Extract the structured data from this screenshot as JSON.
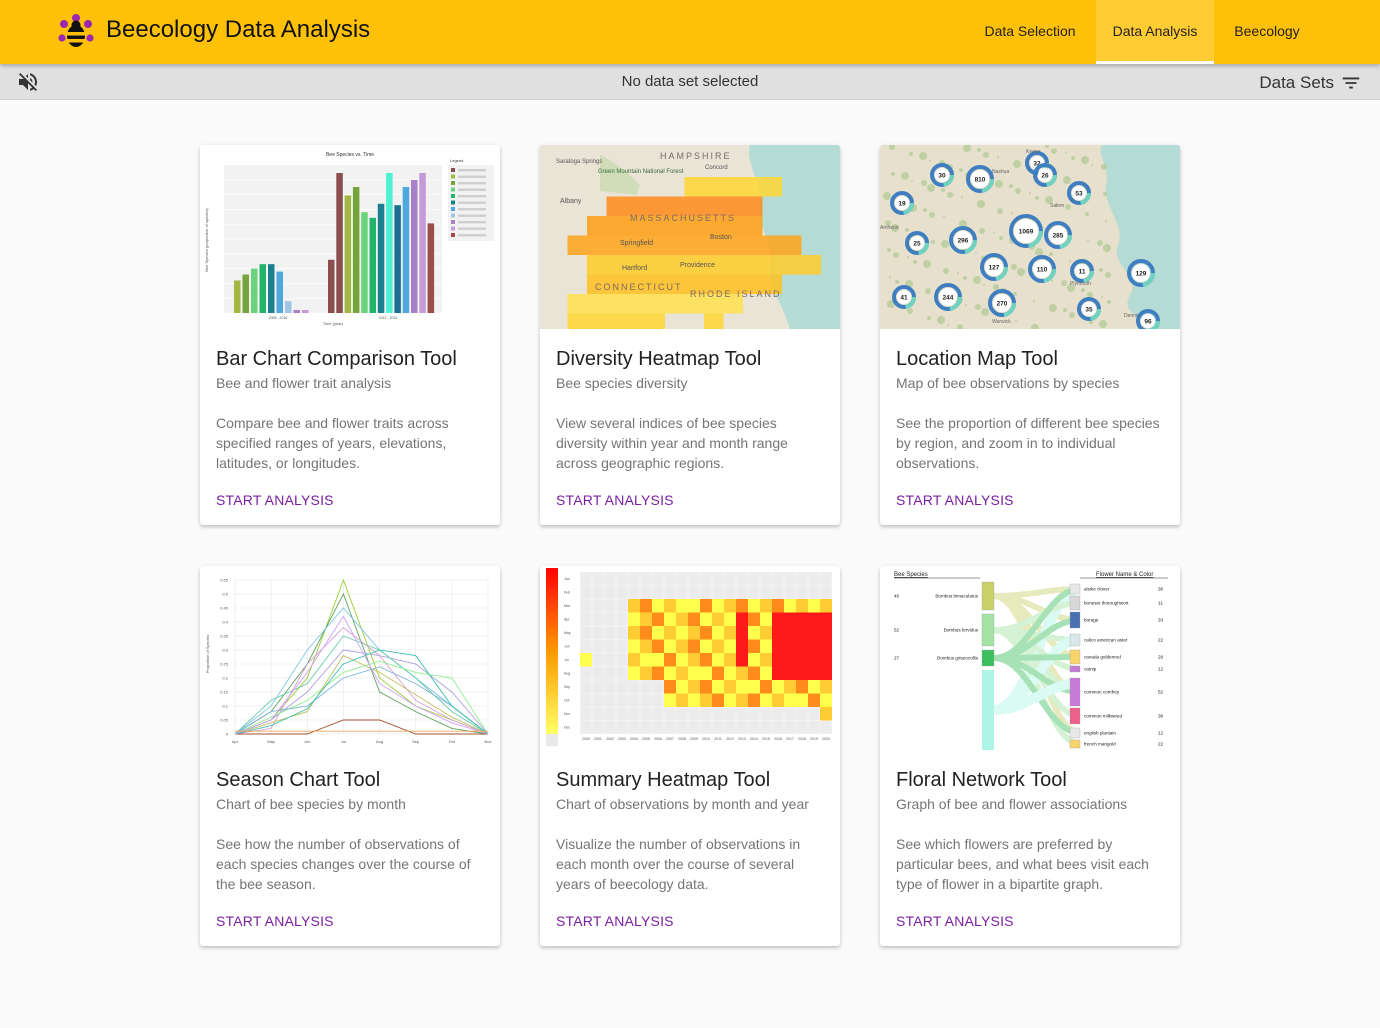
{
  "header": {
    "app_title": "Beecology Data Analysis",
    "nav": [
      {
        "label": "Data Selection",
        "active": false
      },
      {
        "label": "Data Analysis",
        "active": true
      },
      {
        "label": "Beecology",
        "active": false
      }
    ],
    "brand_color": "#ffc107"
  },
  "subbar": {
    "mute_icon": "volume-off-icon",
    "status": "No data set selected",
    "datasets_label": "Data Sets",
    "filter_icon": "filter-icon"
  },
  "cards": [
    {
      "title": "Bar Chart Comparison Tool",
      "subtitle": "Bee and flower trait analysis",
      "description": "Compare bee and flower traits across specified ranges of years, elevations, latitudes, or longitudes.",
      "action": "START ANALYSIS"
    },
    {
      "title": "Diversity Heatmap Tool",
      "subtitle": "Bee species diversity",
      "description": "View several indices of bee species diversity within year and month range across geographic regions.",
      "action": "START ANALYSIS"
    },
    {
      "title": "Location Map Tool",
      "subtitle": "Map of bee observations by species",
      "description": "See the proportion of different bee species by region, and zoom in to individual observations.",
      "action": "START ANALYSIS"
    },
    {
      "title": "Season Chart Tool",
      "subtitle": "Chart of bee species by month",
      "description": "See how the number of observations of each species changes over the course of the bee season.",
      "action": "START ANALYSIS"
    },
    {
      "title": "Summary Heatmap Tool",
      "subtitle": "Chart of observations by month and year",
      "description": "Visualize the number of observations in each month over the course of several years of beecology data.",
      "action": "START ANALYSIS"
    },
    {
      "title": "Floral Network Tool",
      "subtitle": "Graph of bee and flower associations",
      "description": "See which flowers are preferred by particular bees, and what bees visit each type of flower in a bipartite graph.",
      "action": "START ANALYSIS"
    }
  ],
  "thumbnails": {
    "bar_chart": {
      "title": "Bee Species vs. Time",
      "ylabel": "Bee Species (proportion of species)",
      "xlabel": "Time (year)",
      "legend_title": "Legend",
      "group_labels": [
        "2008 - 2016",
        "2012 - 2019"
      ]
    },
    "map_labels": {
      "diversity": [
        "HAMPSHIRE",
        "MASSACHUSETTS",
        "CONNECTICUT",
        "RHODE ISLAND",
        "Albany",
        "Saratoga Springs",
        "Green Mountain National Forest",
        "Concord",
        "Boston",
        "Springfield",
        "Hartford",
        "Providence"
      ],
      "location": [
        "Keene",
        "Nashua",
        "Salem",
        "Amherst",
        "Plymouth",
        "Dennis",
        "Warwick"
      ]
    },
    "clusters": [
      32,
      30,
      810,
      26,
      53,
      19,
      1069,
      285,
      25,
      296,
      127,
      110,
      11,
      129,
      41,
      244,
      270,
      35,
      96
    ],
    "season_months": [
      "Apr",
      "May",
      "Jun",
      "Jul",
      "Aug",
      "Sep",
      "Oct",
      "Nov"
    ],
    "season_ylabel": "Proportion of Species",
    "season_yticks": [
      "0.55",
      "0.5",
      "0.45",
      "0.4",
      "0.35",
      "0.3",
      "0.25",
      "0.2",
      "0.15",
      "0.1",
      "0.05",
      "0"
    ],
    "summary_months": [
      "Jan",
      "Feb",
      "Mar",
      "Apr",
      "May",
      "Jun",
      "Jul",
      "Aug",
      "Sep",
      "Oct",
      "Nov",
      "Dec"
    ],
    "summary_years": [
      "2000",
      "2001",
      "2002",
      "2003",
      "2004",
      "2005",
      "2006",
      "2007",
      "2008",
      "2009",
      "2010",
      "2011",
      "2012",
      "2013",
      "2014",
      "2015",
      "2016",
      "2017",
      "2018",
      "2019",
      "2020"
    ],
    "network": {
      "left_header": "Bee Species",
      "right_header": "Flower Name & Color",
      "bees": [
        {
          "name": "Bombus bimaculatus",
          "count": "46"
        },
        {
          "name": "Bombus fervidus",
          "count": "52"
        },
        {
          "name": "Bombus griseocollis",
          "count": "27"
        }
      ],
      "flowers": [
        {
          "name": "alsike clover",
          "count": "36"
        },
        {
          "name": "boneset thoroughwort",
          "count": "11"
        },
        {
          "name": "borage",
          "count": "33"
        },
        {
          "name": "calico american aster",
          "count": "22"
        },
        {
          "name": "canada goldenrod",
          "count": "29"
        },
        {
          "name": "catnip",
          "count": "12"
        },
        {
          "name": "common comfrey",
          "count": "52"
        },
        {
          "name": "common milkweed",
          "count": "38"
        },
        {
          "name": "english plantain",
          "count": "12"
        },
        {
          "name": "french marigold",
          "count": "22"
        }
      ]
    }
  }
}
